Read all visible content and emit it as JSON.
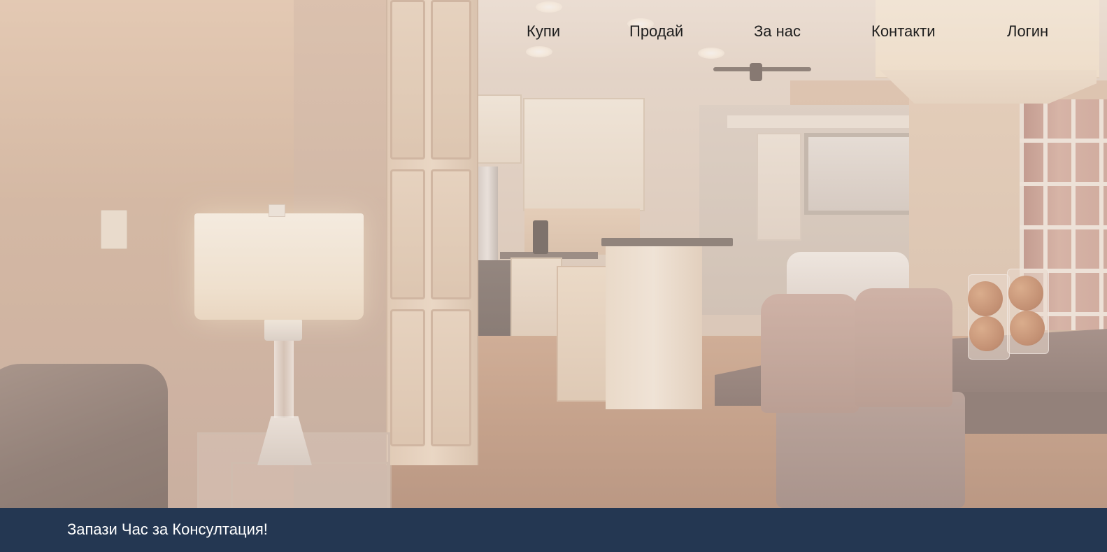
{
  "nav": {
    "items": [
      {
        "label": "Купи"
      },
      {
        "label": "Продай"
      },
      {
        "label": "За нас"
      },
      {
        "label": "Контакти"
      },
      {
        "label": "Логин"
      }
    ]
  },
  "cta": {
    "label": "Запази Час за Консултация!"
  },
  "colors": {
    "cta_bar": "#243752",
    "nav_text": "#1e1e1e",
    "cta_text": "#ffffff"
  }
}
